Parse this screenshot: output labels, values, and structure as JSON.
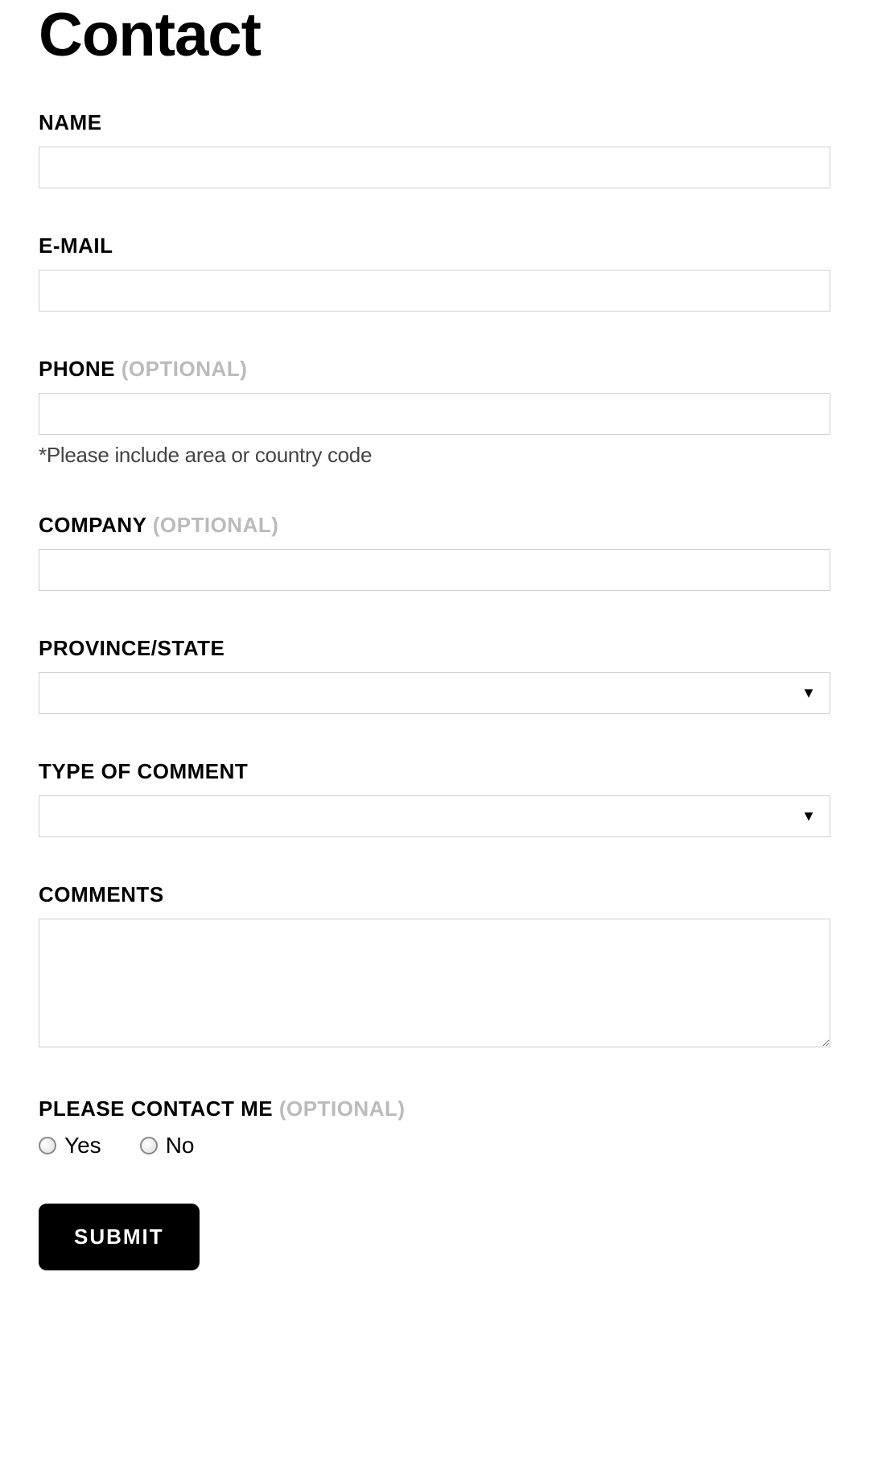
{
  "page": {
    "title": "Contact"
  },
  "form": {
    "name": {
      "label": "NAME",
      "value": ""
    },
    "email": {
      "label": "E-MAIL",
      "value": ""
    },
    "phone": {
      "label": "PHONE",
      "optional_tag": "(OPTIONAL)",
      "value": "",
      "hint": "*Please include area or country code"
    },
    "company": {
      "label": "COMPANY",
      "optional_tag": "(OPTIONAL)",
      "value": ""
    },
    "province": {
      "label": "PROVINCE/STATE",
      "selected": ""
    },
    "comment_type": {
      "label": "TYPE OF COMMENT",
      "selected": ""
    },
    "comments": {
      "label": "COMMENTS",
      "value": ""
    },
    "contact_me": {
      "label": "PLEASE CONTACT ME",
      "optional_tag": "(OPTIONAL)",
      "options": {
        "yes": "Yes",
        "no": "No"
      }
    },
    "submit_label": "SUBMIT"
  }
}
